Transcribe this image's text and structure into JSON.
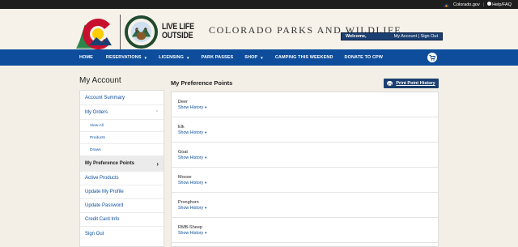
{
  "utility_bar": {
    "colorado_link": "Colorado.gov",
    "separator": "|",
    "help_link": "Help/FAQ"
  },
  "header": {
    "tagline_line1": "LIVE LIFE",
    "tagline_line2": "OUTSIDE",
    "agency_name": "COLORADO PARKS AND WILDLIFE",
    "seal_text_top": "COLORADO",
    "seal_text_bottom": "PARKS & WILDLIFE",
    "welcome_label": "Welcome,",
    "account_links": "My Account | Sign Out"
  },
  "nav": {
    "items": [
      {
        "label": "HOME",
        "dropdown": false
      },
      {
        "label": "RESERVATIONS",
        "dropdown": true
      },
      {
        "label": "LICENSING",
        "dropdown": true
      },
      {
        "label": "PARK PASSES",
        "dropdown": false
      },
      {
        "label": "SHOP",
        "dropdown": true
      },
      {
        "label": "CAMPING THIS WEEKEND",
        "dropdown": false
      },
      {
        "label": "DONATE TO CPW",
        "dropdown": false
      }
    ],
    "cart_icon": "shopping-cart-icon"
  },
  "page": {
    "title": "My Account"
  },
  "sidebar": {
    "items": [
      {
        "label": "Account Summary",
        "level": "top"
      },
      {
        "label": "My Orders",
        "level": "top",
        "expanded": true
      },
      {
        "label": "View All",
        "level": "sub"
      },
      {
        "label": "Products",
        "level": "sub"
      },
      {
        "label": "Draws",
        "level": "sub"
      },
      {
        "label": "My Preference Points",
        "level": "top",
        "active": true
      },
      {
        "label": "Active Products",
        "level": "top"
      },
      {
        "label": "Update My Profile",
        "level": "top"
      },
      {
        "label": "Update Password",
        "level": "top"
      },
      {
        "label": "Credit Card Info",
        "level": "top"
      },
      {
        "label": "Sign Out",
        "level": "top"
      }
    ]
  },
  "main": {
    "title": "My Preference Points",
    "print_button": "Print Point History",
    "show_history_label": "Show History",
    "species": [
      "Deer",
      "Elk",
      "Goat",
      "Moose",
      "Pronghorn",
      "RMB-Sheep"
    ]
  },
  "colors": {
    "nav_blue": "#0d4d9c",
    "dark_navy": "#1b3f70",
    "page_bg": "#f3efe6",
    "link_blue": "#0d4d9c"
  }
}
